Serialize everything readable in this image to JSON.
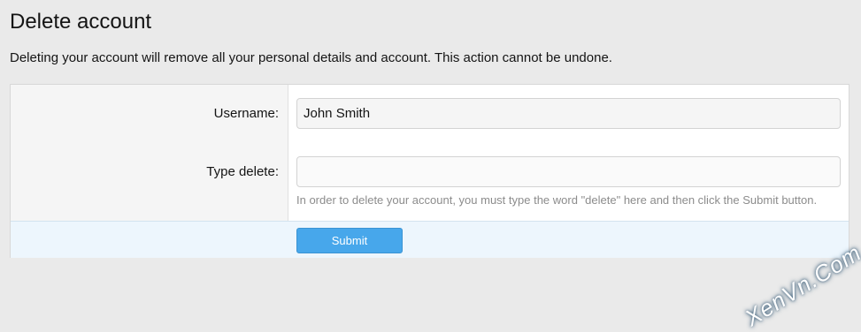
{
  "title": "Delete account",
  "description": "Deleting your account will remove all your personal details and account. This action cannot be undone.",
  "form": {
    "username_label": "Username:",
    "username_value": "John Smith",
    "type_delete_label": "Type delete:",
    "type_delete_value": "",
    "hint": "In order to delete your account, you must type the word \"delete\" here and then click the Submit button.",
    "submit_label": "Submit"
  },
  "watermark": "XenVn.Com",
  "colors": {
    "submit": "#47a7eb",
    "footer": "#edf6fd",
    "page_bg": "#eaeaea"
  }
}
